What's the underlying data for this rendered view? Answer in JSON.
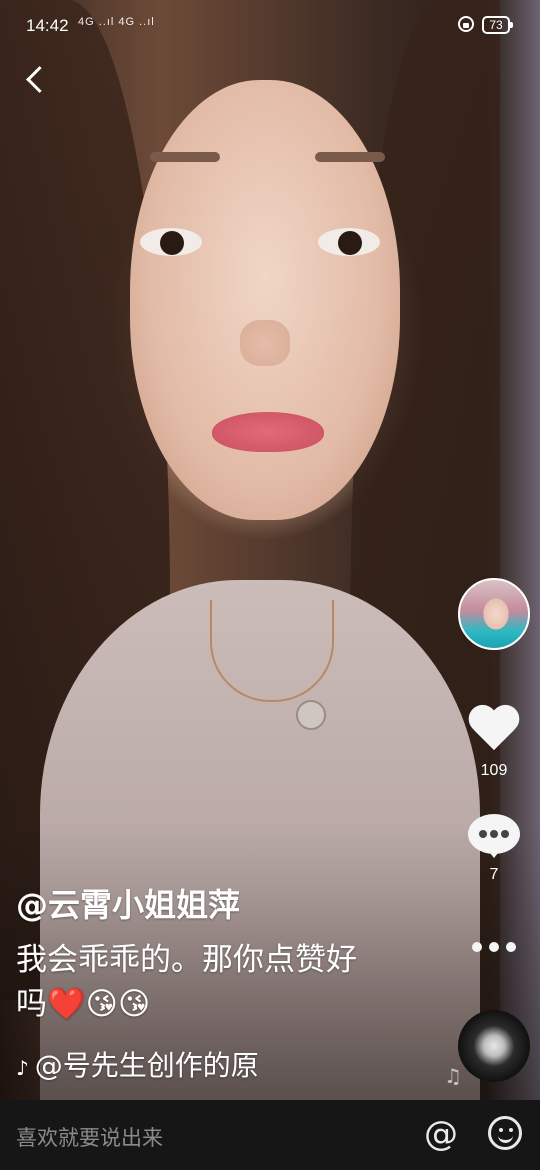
{
  "status_bar": {
    "time": "14:42",
    "signal_text": "4G ..ıl 4G ..ıl",
    "battery": "73"
  },
  "video": {
    "author": "@云霄小姐姐萍",
    "caption": "我会乖乖的。那你点赞好吗",
    "caption_emojis": [
      "❤️",
      "😘",
      "😘"
    ],
    "music_text": "@号先生创作的原"
  },
  "actions": {
    "like_count": "109",
    "comment_count": "7"
  },
  "input_bar": {
    "placeholder": "喜欢就要说出来",
    "at_symbol": "@"
  },
  "icons": {
    "back": "back-arrow-icon",
    "like": "heart-icon",
    "comment": "comment-icon",
    "more": "more-icon",
    "music": "music-disc-icon",
    "mention": "at-icon",
    "emoji": "emoji-icon"
  }
}
